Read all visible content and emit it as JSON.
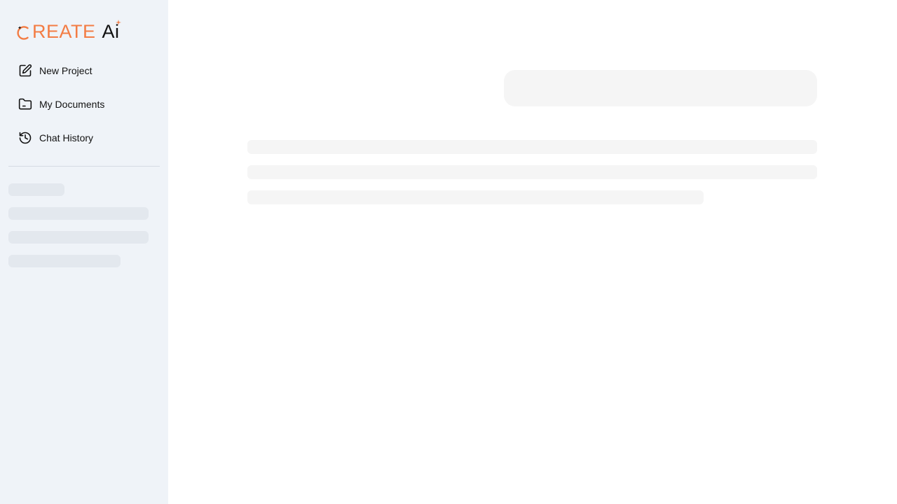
{
  "brand": {
    "name_first": "C",
    "name_rest": "REATE",
    "name_ai": "Ai",
    "accent_color": "#f37c44",
    "text_color": "#111111"
  },
  "sidebar": {
    "items": [
      {
        "label": "New Project",
        "icon": "edit-icon"
      },
      {
        "label": "My Documents",
        "icon": "folder-icon"
      },
      {
        "label": "Chat History",
        "icon": "history-icon"
      }
    ],
    "loading_placeholders": 4
  },
  "main": {
    "state": "loading",
    "prompt_placeholder": "",
    "response_placeholder_lines": 3
  }
}
